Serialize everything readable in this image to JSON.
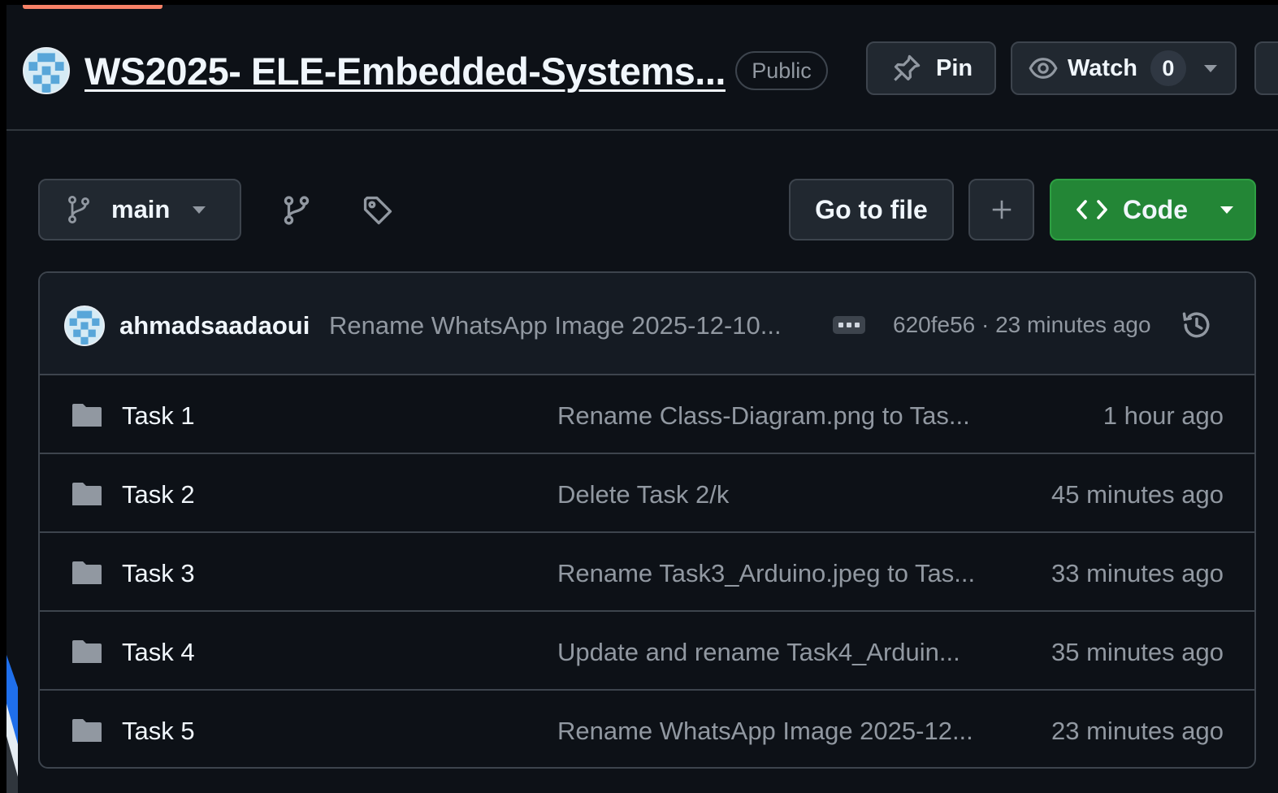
{
  "repo": {
    "title": "WS2025-  ELE-Embedded-Systems...",
    "visibility": "Public",
    "pin_label": "Pin",
    "watch_label": "Watch",
    "watch_count": "0"
  },
  "toolbar": {
    "branch": "main",
    "goto_file": "Go to file",
    "code_label": "Code"
  },
  "latest_commit": {
    "author": "ahmadsaadaoui",
    "message": "Rename WhatsApp Image 2025-12-10...",
    "meta": "620fe56 · 23 minutes ago"
  },
  "files": [
    {
      "name": "Task 1",
      "message": "Rename Class-Diagram.png to Tas...",
      "time": "1 hour ago"
    },
    {
      "name": "Task 2",
      "message": "Delete Task 2/k",
      "time": "45 minutes ago"
    },
    {
      "name": "Task 3",
      "message": "Rename Task3_Arduino.jpeg to Tas...",
      "time": "33 minutes ago"
    },
    {
      "name": "Task 4",
      "message": "Update and rename Task4_Arduin...",
      "time": "35 minutes ago"
    },
    {
      "name": "Task 5",
      "message": "Rename WhatsApp Image 2025-12...",
      "time": "23 minutes ago"
    }
  ],
  "icons": {
    "repo_avatar": "identicon-avatar",
    "pin": "pin-icon",
    "watch": "eye-icon",
    "branch": "git-branch-icon",
    "branches": "branches-icon",
    "tags": "tag-icon",
    "plus": "plus-icon",
    "code": "code-icon",
    "ellipsis": "ellipsis-icon",
    "history": "history-icon",
    "folder": "folder-icon"
  },
  "colors": {
    "page_bg": "#0d1117",
    "border": "#3d444d",
    "code_button": "#238636",
    "muted_text": "#9198a1",
    "folder": "#9198a1",
    "accent_tab": "#f78166"
  }
}
